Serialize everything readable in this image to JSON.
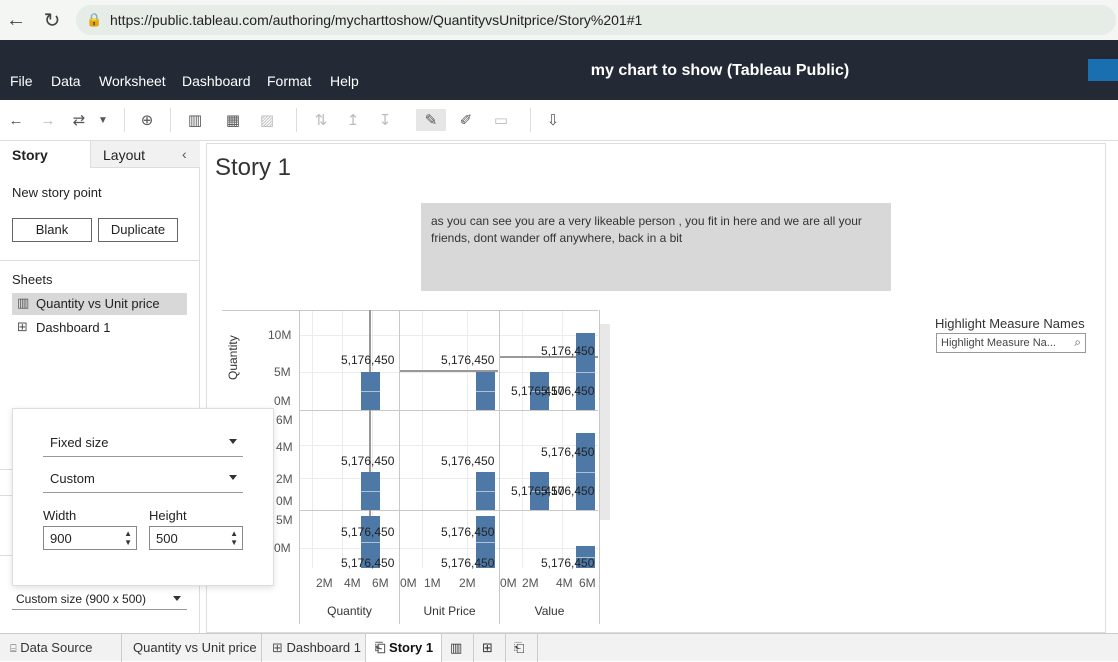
{
  "browser": {
    "url": "https://public.tableau.com/authoring/mycharttoshow/QuantityvsUnitprice/Story%201#1"
  },
  "app": {
    "title": "my chart to show (Tableau Public)",
    "menu": [
      "File",
      "Data",
      "Worksheet",
      "Dashboard",
      "Format",
      "Help"
    ]
  },
  "left_pane": {
    "tabs": [
      "Story",
      "Layout"
    ],
    "new_story_point_label": "New story point",
    "blank_label": "Blank",
    "duplicate_label": "Duplicate",
    "sheets_heading": "Sheets",
    "sheets": [
      "Quantity vs Unit price",
      "Dashboard 1"
    ],
    "size_select": "Custom size (900 x 500)"
  },
  "size_popup": {
    "size_mode": "Fixed size",
    "preset": "Custom",
    "width_label": "Width",
    "width_value": "900",
    "height_label": "Height",
    "height_value": "500"
  },
  "story": {
    "title": "Story 1",
    "caption": "as you can see you are a very likeable person , you fit in here and we are all your friends, dont wander off anywhere, back in a bit"
  },
  "highlight": {
    "label": "Highlight Measure Names",
    "placeholder": "Highlight Measure Na..."
  },
  "chart_data": {
    "type": "bar",
    "ylabel": "Quantity",
    "columns": [
      "Quantity",
      "Unit Price",
      "Value"
    ],
    "row1_ticks": [
      "10M",
      "5M",
      "0M"
    ],
    "row2_ticks": [
      "6M",
      "4M",
      "2M",
      "0M"
    ],
    "row3_ticks": [
      "5M",
      "0M"
    ],
    "x_ticks": {
      "Quantity": [
        "2M",
        "4M",
        "6M"
      ],
      "Unit Price": [
        "0M",
        "1M",
        "2M"
      ],
      "Value": [
        "0M",
        "2M",
        "4M",
        "6M"
      ]
    },
    "value_label": "5,176,450",
    "values": [
      5176450,
      5176450,
      5176450
    ]
  },
  "bottom_tabs": [
    "Data Source",
    "Quantity vs Unit price",
    "Dashboard 1",
    "Story 1"
  ],
  "colors": {
    "bar": "#4e79a7",
    "header": "#232a36",
    "accent": "#1a6fb0"
  }
}
